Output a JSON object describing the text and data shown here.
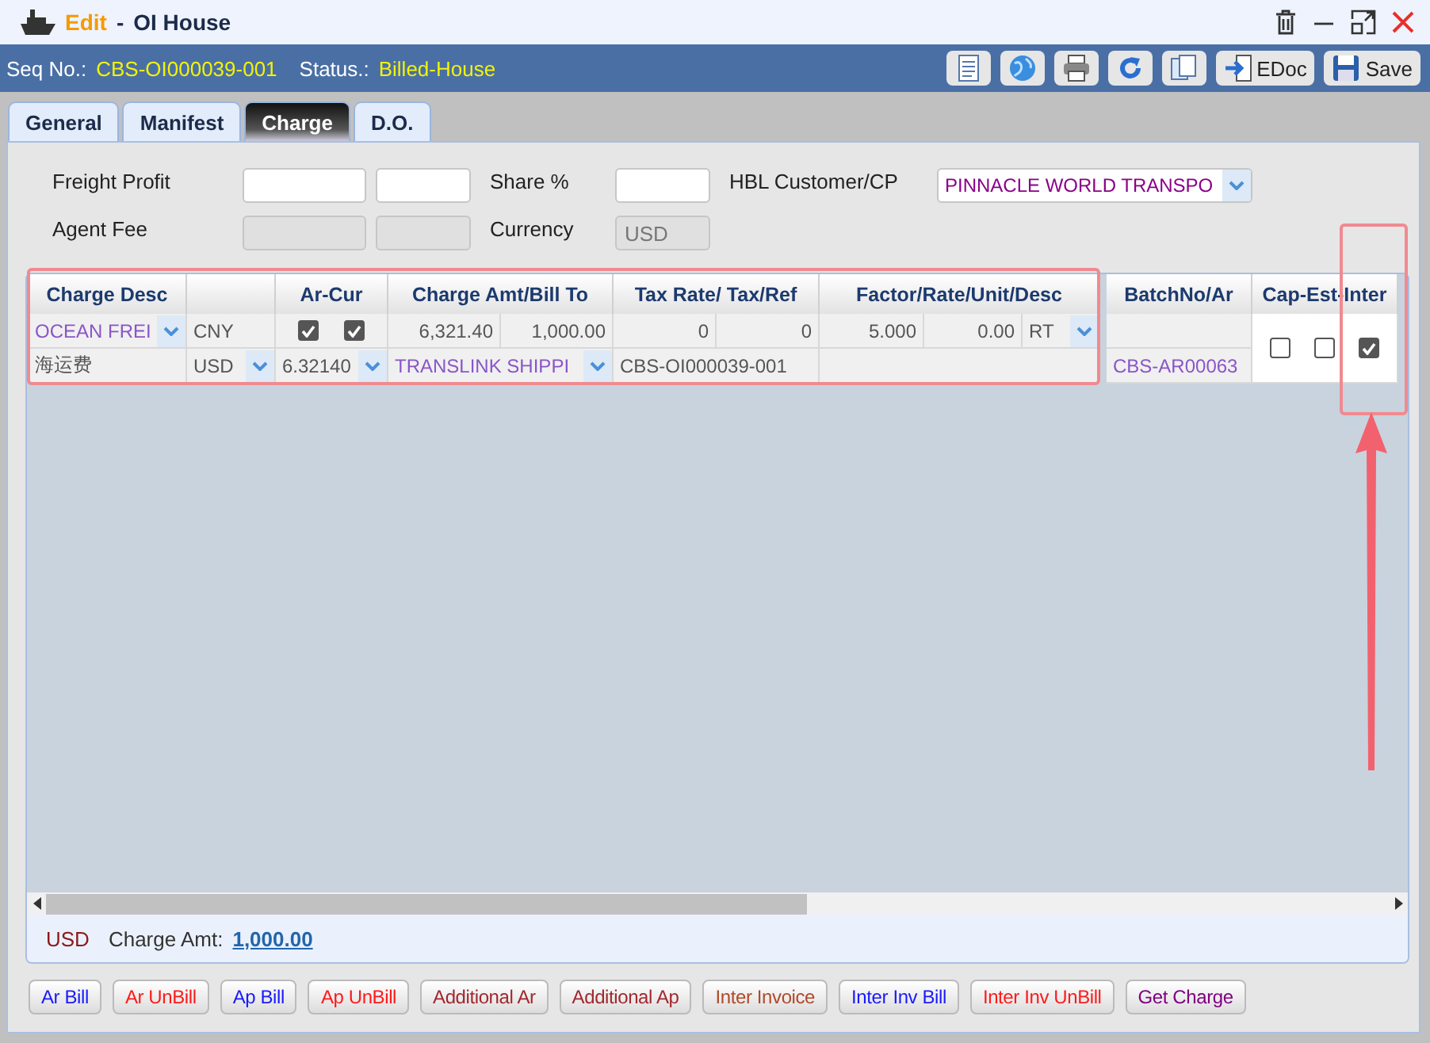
{
  "window": {
    "action": "Edit",
    "separator": "-",
    "title": "OI House"
  },
  "header": {
    "seq_label": "Seq No.:",
    "seq_value": "CBS-OI000039-001",
    "status_label": "Status.:",
    "status_value": "Billed-House"
  },
  "toolbar": [
    {
      "kind": "document"
    },
    {
      "kind": "globe"
    },
    {
      "kind": "print"
    },
    {
      "kind": "refresh"
    },
    {
      "kind": "copy"
    },
    {
      "kind": "edoc",
      "label": "EDoc"
    },
    {
      "kind": "save",
      "label": "Save"
    }
  ],
  "tabs": [
    {
      "label": "General",
      "selected": false
    },
    {
      "label": "Manifest",
      "selected": false
    },
    {
      "label": "Charge",
      "selected": true
    },
    {
      "label": "D.O.",
      "selected": false
    }
  ],
  "form": [
    {
      "label": "Freight Profit",
      "fields": [
        {
          "disabled": false
        },
        {
          "disabled": false
        }
      ],
      "label2": "Share %",
      "field2": {
        "disabled": false
      },
      "label3": "HBL Customer/CP",
      "select3": "PINNACLE WORLD TRANSPO"
    },
    {
      "label": "Agent Fee",
      "fields": [
        {
          "disabled": true
        },
        {
          "disabled": true
        }
      ],
      "label2": "Currency",
      "field2": {
        "disabled": true,
        "value": "USD"
      }
    }
  ],
  "grid": {
    "columns": [
      "Charge Desc",
      "Ar-Cur",
      "Charge Amt/Bill To",
      "Tax Rate/ Tax/Ref",
      "Factor/Rate/Unit/Desc",
      "BatchNo/Ar",
      "Cap-Est-Inter"
    ],
    "rows": [
      {
        "charge_desc": "OCEAN FREI",
        "currency": "CNY",
        "ar_checks": [
          true,
          true
        ],
        "charge_amt": "6,321.40",
        "bill_amt": "1,000.00",
        "tax_rate": "0",
        "tax": "0",
        "factor": "5.000",
        "rate": "0.00",
        "unit": "RT",
        "local_name": "海运费",
        "bill_currency": "USD",
        "exchange_rate": "6.32140",
        "bill_to": "TRANSLINK SHIPPI",
        "reference": "CBS-OI000039-001",
        "batch_no": "CBS-AR00063",
        "cap_est_inter": [
          false,
          false,
          true
        ]
      }
    ]
  },
  "totals": {
    "currency": "USD",
    "label": "Charge Amt:",
    "value": "1,000.00"
  },
  "actions": [
    {
      "label": "Ar Bill",
      "color": "#1a1aff"
    },
    {
      "label": "Ar UnBill",
      "color": "#ff1a1a"
    },
    {
      "label": "Ap Bill",
      "color": "#1a1aff"
    },
    {
      "label": "Ap UnBill",
      "color": "#ff1a1a"
    },
    {
      "label": "Additional Ar",
      "color": "#a3282e"
    },
    {
      "label": "Additional Ap",
      "color": "#a3282e"
    },
    {
      "label": "Inter Invoice",
      "color": "#b04a2a"
    },
    {
      "label": "Inter Inv Bill",
      "color": "#1a1aff"
    },
    {
      "label": "Inter Inv UnBill",
      "color": "#ff1a1a"
    },
    {
      "label": "Get Charge",
      "color": "#800080"
    }
  ]
}
